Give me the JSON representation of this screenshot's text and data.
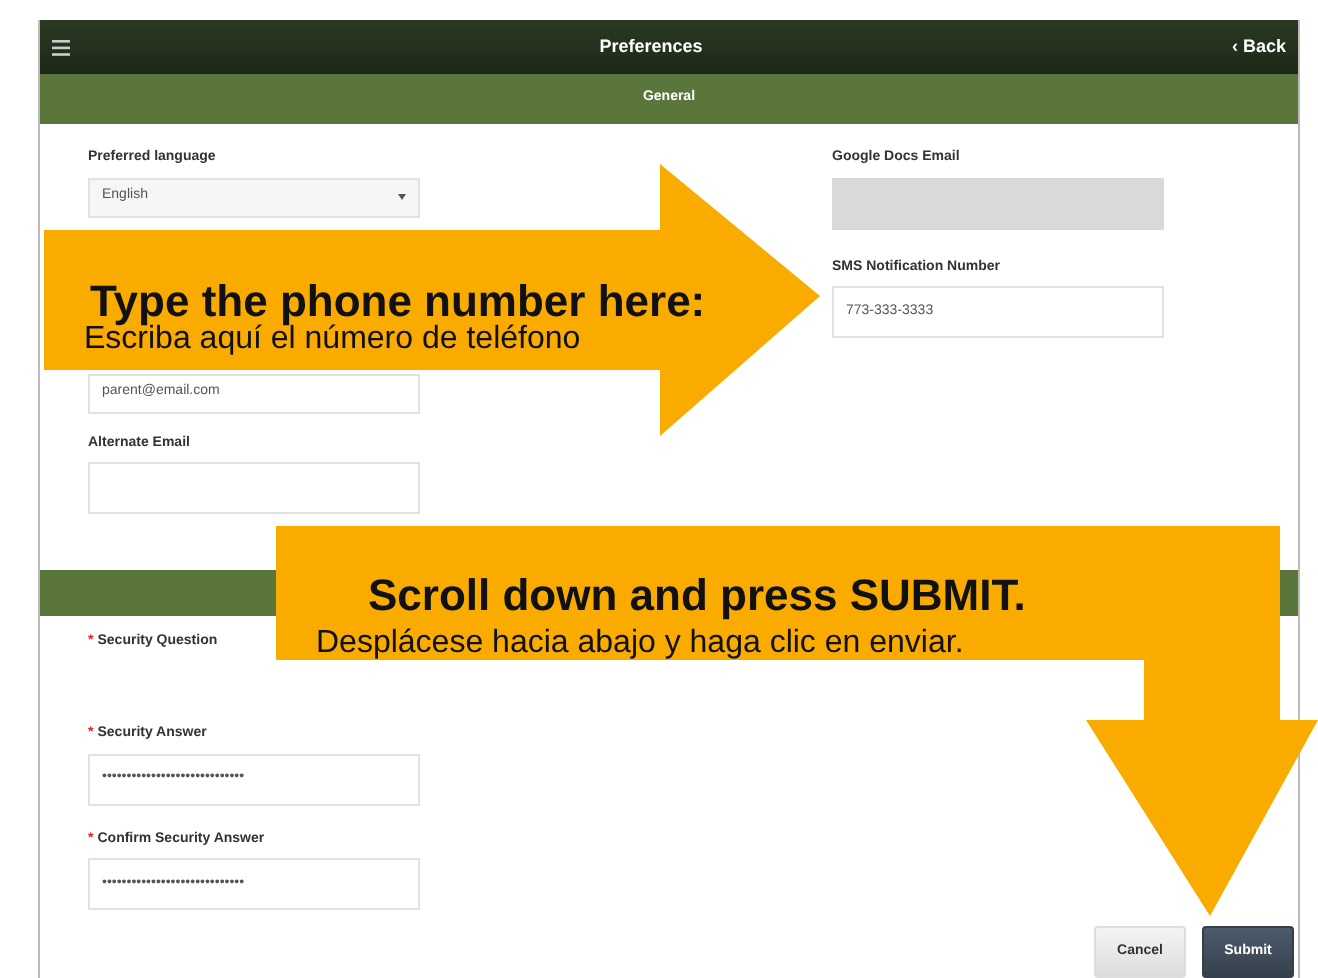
{
  "header": {
    "title": "Preferences",
    "back": "‹ Back"
  },
  "section": {
    "title": "General"
  },
  "left_fields": [
    {
      "label": "Preferred language",
      "kind": "select",
      "value": "English"
    },
    {
      "kind": "text",
      "placeholder": "parent@email.com"
    },
    {
      "label": "Alternate Email",
      "kind": "text"
    }
  ],
  "right_fields": [
    {
      "label": "Google Docs Email",
      "kind": "disabled"
    },
    {
      "label": "SMS Notification Number",
      "kind": "text",
      "value": "773-333-3333"
    }
  ],
  "security_fields": [
    {
      "marker": "*",
      "label": "Security Question",
      "kind": "none"
    },
    {
      "marker": "*",
      "label": "Security Answer",
      "kind": "text",
      "value": "•••••••••••••••••••••••••••••"
    },
    {
      "marker": "*",
      "label": "Confirm Security Answer",
      "kind": "text",
      "value": "•••••••••••••••••••••••••••••"
    }
  ],
  "buttons": [
    {
      "label": "Cancel",
      "kind": "secondary"
    },
    {
      "label": "Submit",
      "kind": "primary"
    }
  ],
  "callouts": [
    {
      "title": "Type the phone number here:",
      "subtitle": "Escriba aquí el número de teléfono"
    },
    {
      "title": "Scroll down and press SUBMIT.",
      "subtitle": "Desplácese hacia abajo y haga clic en enviar."
    }
  ]
}
